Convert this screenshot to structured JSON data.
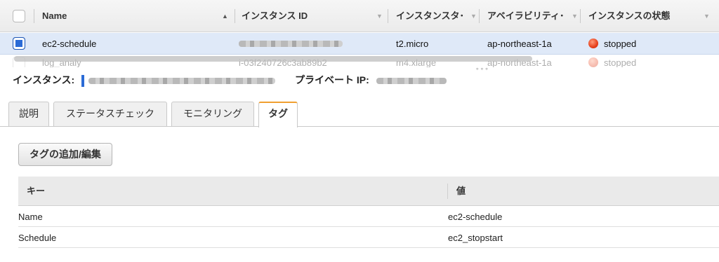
{
  "instances_table": {
    "columns": [
      {
        "label": "Name",
        "sort_icon": "▲"
      },
      {
        "label": "インスタンス ID",
        "sort_icon": "▼"
      },
      {
        "label": "インスタンスタ･",
        "sort_icon": "▼"
      },
      {
        "label": "アベイラビリティ･",
        "sort_icon": "▼"
      },
      {
        "label": "インスタンスの状態",
        "sort_icon": "▼"
      }
    ],
    "rows": [
      {
        "name": "ec2-schedule",
        "instance_id": "",
        "type": "t2.micro",
        "az": "ap-northeast-1a",
        "state": "stopped",
        "selected": true
      },
      {
        "name": "log_analy",
        "instance_id": "i-03f240726c3ab89b2",
        "type": "m4.xlarge",
        "az": "ap-northeast-1a",
        "state": "stopped",
        "selected": false
      }
    ],
    "status_colors": {
      "stopped": "#e6401c"
    }
  },
  "details": {
    "instance_label": "インスタンス:",
    "private_ip_label": "プライベート IP:",
    "tabs": [
      "説明",
      "ステータスチェック",
      "モニタリング",
      "タグ"
    ],
    "active_tab": "タグ",
    "add_edit_tags_button": "タグの追加/編集",
    "tags_table": {
      "headers": {
        "key": "キー",
        "value": "値"
      },
      "rows": [
        {
          "key": "Name",
          "value": "ec2-schedule"
        },
        {
          "key": "Schedule",
          "value": "ec2_stopstart"
        }
      ]
    }
  },
  "colors": {
    "accent_blue": "#2b6bd6",
    "active_tab_border": "#f0a030"
  }
}
